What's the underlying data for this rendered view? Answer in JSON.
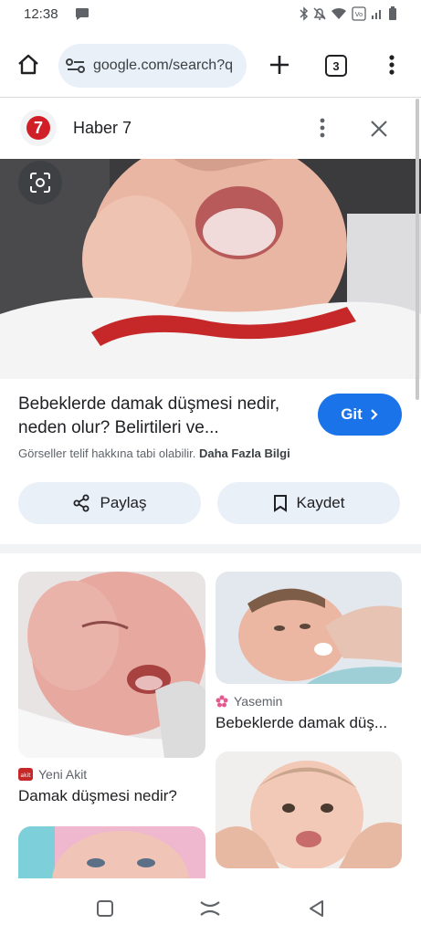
{
  "status_bar": {
    "time": "12:38"
  },
  "toolbar": {
    "url": "google.com/search?q",
    "tab_count": "3"
  },
  "source": {
    "name": "Haber 7",
    "logo_text": "7"
  },
  "result": {
    "title": "Bebeklerde damak düşmesi nedir, neden olur? Belirtileri ve...",
    "go_label": "Git",
    "copyright": "Görseller telif hakkına tabi olabilir.",
    "more_info": "Daha Fazla Bilgi",
    "share_label": "Paylaş",
    "save_label": "Kaydet"
  },
  "related": [
    {
      "source": "Yasemin",
      "title": "Bebeklerde damak düş..."
    },
    {
      "source": "Yeni Akit",
      "title": "Damak düşmesi nedir?"
    }
  ],
  "colors": {
    "accent": "#1a73e8",
    "omnibox": "#eaf0f8",
    "brand_red": "#d01f26"
  }
}
